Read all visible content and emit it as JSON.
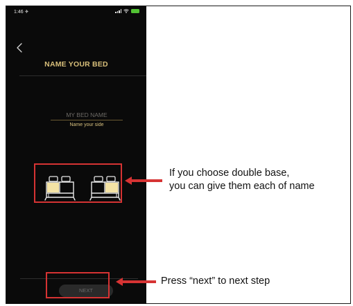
{
  "status_bar": {
    "time": "1:46 ✈",
    "battery_color": "#52c234"
  },
  "header": {
    "back_icon": "chevron-left-icon",
    "title": "NAME YOUR BED"
  },
  "name_field": {
    "placeholder": "MY BED NAME",
    "helper": "Name your side"
  },
  "bed_options": [
    {
      "icon": "bed-left-side-icon"
    },
    {
      "icon": "bed-right-side-icon"
    }
  ],
  "next_button": {
    "label": "NEXT"
  },
  "annotations": {
    "beds_line1": "If you choose double base,",
    "beds_line2": "you can give them each of name",
    "next": "Press “next” to next step"
  },
  "colors": {
    "accent_gold": "#d8bf7a",
    "highlight_red": "#d63333",
    "phone_bg": "#0a0a0a"
  }
}
